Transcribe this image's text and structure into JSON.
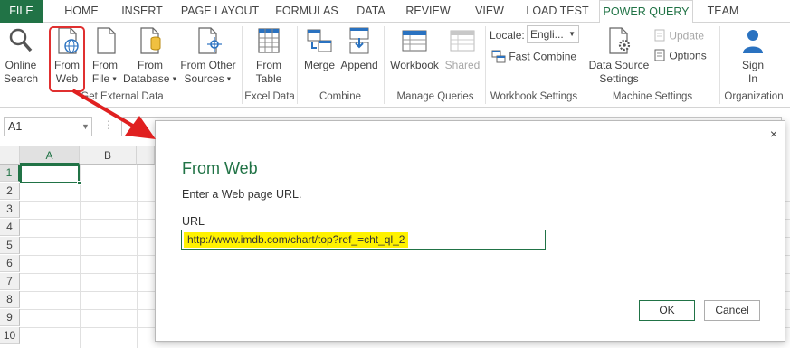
{
  "tabs": [
    {
      "label": "FILE"
    },
    {
      "label": "HOME"
    },
    {
      "label": "INSERT"
    },
    {
      "label": "PAGE LAYOUT"
    },
    {
      "label": "FORMULAS"
    },
    {
      "label": "DATA"
    },
    {
      "label": "REVIEW"
    },
    {
      "label": "VIEW"
    },
    {
      "label": "LOAD TEST"
    },
    {
      "label": "POWER QUERY"
    },
    {
      "label": "TEAM"
    }
  ],
  "ribbon": {
    "online_search": {
      "line1": "Online",
      "line2": "Search"
    },
    "from_web": {
      "line1": "From",
      "line2": "Web"
    },
    "from_file": {
      "line1": "From",
      "line2": "File"
    },
    "from_database": {
      "line1": "From",
      "line2": "Database"
    },
    "from_other": {
      "line1": "From Other",
      "line2": "Sources"
    },
    "from_table": {
      "line1": "From",
      "line2": "Table"
    },
    "merge": {
      "label": "Merge"
    },
    "append": {
      "label": "Append"
    },
    "workbook": {
      "label": "Workbook"
    },
    "shared": {
      "label": "Shared"
    },
    "locale_label": "Locale:",
    "locale_value": "Engli...",
    "fast_combine": "Fast Combine",
    "data_source": {
      "line1": "Data Source",
      "line2": "Settings"
    },
    "update": "Update",
    "options": "Options",
    "sign_in": {
      "line1": "Sign",
      "line2": "In"
    },
    "groups": {
      "get_external": "Get External Data",
      "excel_data": "Excel Data",
      "combine": "Combine",
      "manage_queries": "Manage Queries",
      "workbook_settings": "Workbook Settings",
      "machine_settings": "Machine Settings",
      "organization": "Organization"
    }
  },
  "formula_bar": {
    "name_box": "A1",
    "dots": "⋮"
  },
  "grid": {
    "columns": [
      "A",
      "B"
    ],
    "rows": [
      "1",
      "2",
      "3",
      "4",
      "5",
      "6",
      "7",
      "8",
      "9",
      "10"
    ]
  },
  "dialog": {
    "title": "From Web",
    "prompt": "Enter a Web page URL.",
    "url_label": "URL",
    "url_value": "http://www.imdb.com/chart/top?ref_=cht_ql_2",
    "ok": "OK",
    "cancel": "Cancel",
    "close": "×"
  },
  "colors": {
    "accent": "#217346",
    "highlight": "#fff200",
    "arrow": "#e02020"
  }
}
